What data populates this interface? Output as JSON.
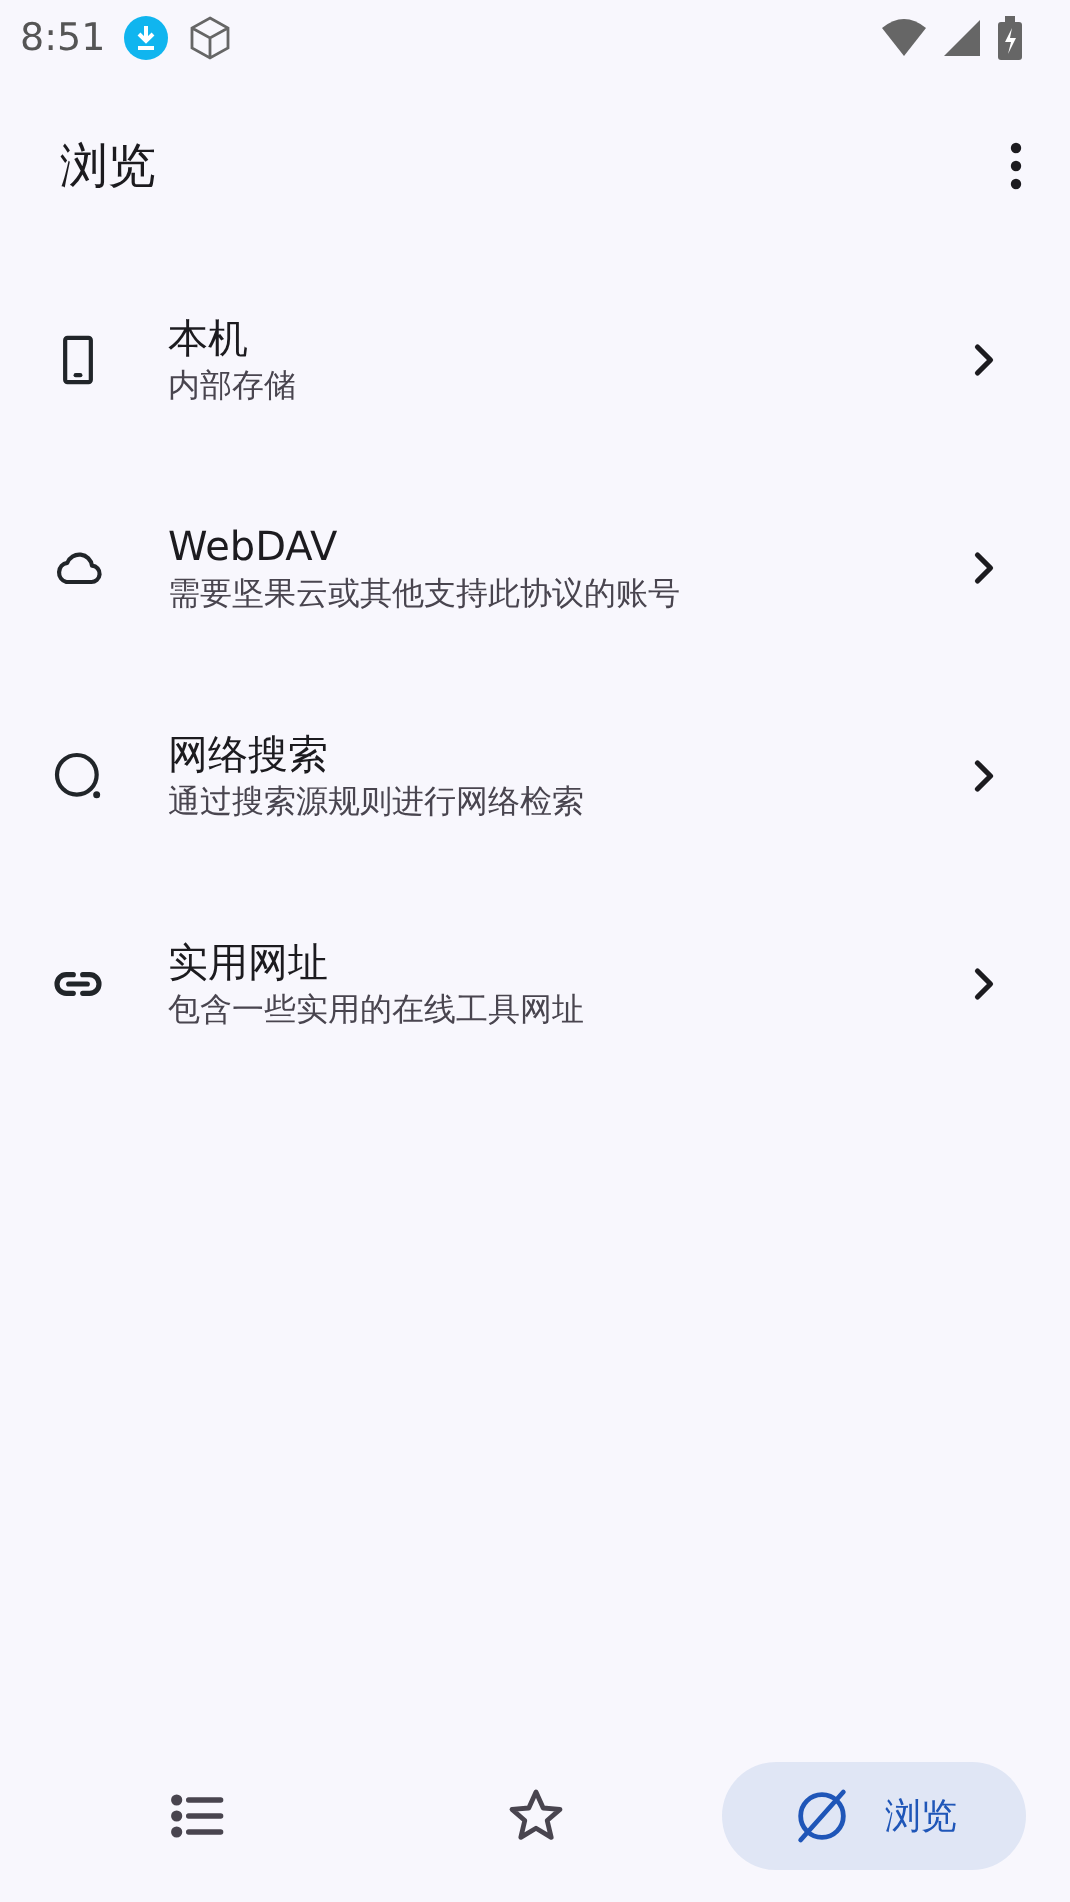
{
  "status_bar": {
    "time": "8:51"
  },
  "app_bar": {
    "title": "浏览"
  },
  "items": [
    {
      "kind": "phone",
      "title": "本机",
      "subtitle": "内部存储"
    },
    {
      "kind": "cloud",
      "title": "WebDAV",
      "subtitle": "需要坚果云或其他支持此协议的账号"
    },
    {
      "kind": "search",
      "title": "网络搜索",
      "subtitle": "通过搜索源规则进行网络检索"
    },
    {
      "kind": "link",
      "title": "实用网址",
      "subtitle": "包含一些实用的在线工具网址"
    }
  ],
  "bottom_nav": [
    {
      "kind": "list",
      "selected": false
    },
    {
      "kind": "star",
      "selected": false
    },
    {
      "kind": "planet",
      "selected": true,
      "label": "浏览"
    }
  ]
}
